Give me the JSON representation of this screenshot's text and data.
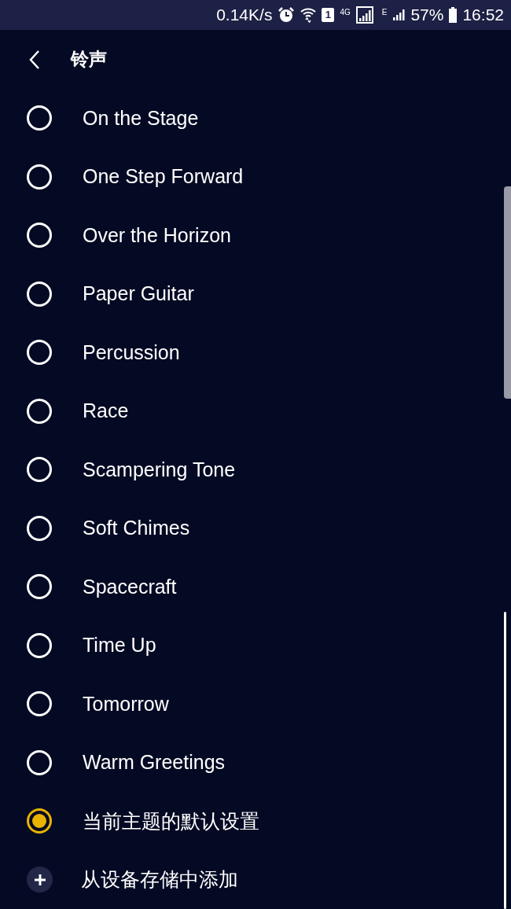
{
  "status_bar": {
    "net_speed": "0.14K/s",
    "sim_badge": "1",
    "network_1": "4G",
    "network_2": "E",
    "battery": "57%",
    "time": "16:52"
  },
  "header": {
    "title": "铃声"
  },
  "ringtones": [
    {
      "label": "On the Stage",
      "selected": false
    },
    {
      "label": "One Step Forward",
      "selected": false
    },
    {
      "label": "Over the Horizon",
      "selected": false
    },
    {
      "label": "Paper Guitar",
      "selected": false
    },
    {
      "label": "Percussion",
      "selected": false
    },
    {
      "label": "Race",
      "selected": false
    },
    {
      "label": "Scampering Tone",
      "selected": false
    },
    {
      "label": "Soft Chimes",
      "selected": false
    },
    {
      "label": "Spacecraft",
      "selected": false
    },
    {
      "label": "Time Up",
      "selected": false
    },
    {
      "label": "Tomorrow",
      "selected": false
    },
    {
      "label": "Warm Greetings",
      "selected": false
    },
    {
      "label": "当前主题的默认设置",
      "selected": true
    }
  ],
  "add_item": {
    "label": "从设备存储中添加"
  }
}
